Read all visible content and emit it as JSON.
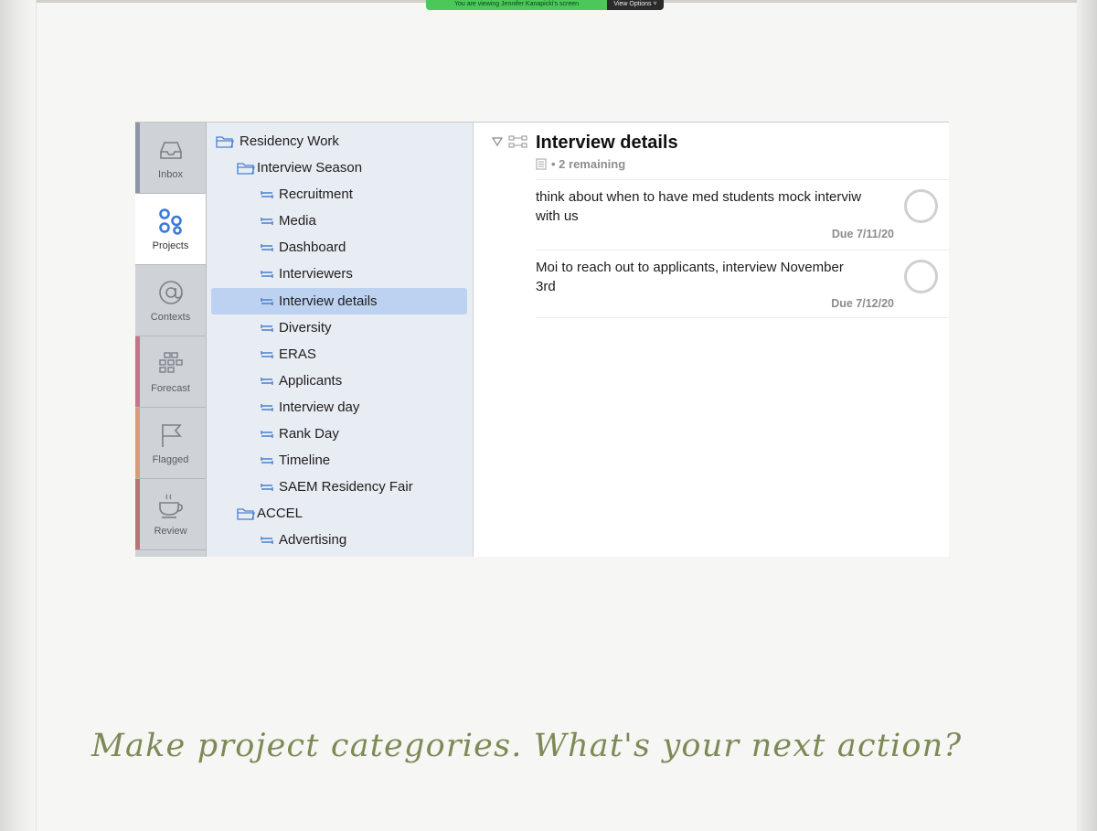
{
  "share_banner": {
    "message": "You are viewing Jennifer Kanapicki's screen",
    "options": "View Options ˅"
  },
  "perspectives": [
    {
      "label": "Inbox",
      "icon": "inbox-icon",
      "color": "#8e95a6"
    },
    {
      "label": "Projects",
      "icon": "projects-icon",
      "color": "#3b7ad8"
    },
    {
      "label": "Contexts",
      "icon": "at-icon",
      "color": "#8a8d92"
    },
    {
      "label": "Forecast",
      "icon": "calendar-grid-icon",
      "color": "#c8738a"
    },
    {
      "label": "Flagged",
      "icon": "flag-icon",
      "color": "#d99b7a"
    },
    {
      "label": "Review",
      "icon": "coffee-cup-icon",
      "color": "#b87576"
    }
  ],
  "sidebar": {
    "items": [
      {
        "label": "Residency Work",
        "type": "folder"
      },
      {
        "label": "Interview Season",
        "type": "folder"
      },
      {
        "label": "Recruitment",
        "type": "project"
      },
      {
        "label": "Media",
        "type": "project"
      },
      {
        "label": "Dashboard",
        "type": "project"
      },
      {
        "label": "Interviewers",
        "type": "project"
      },
      {
        "label": "Interview details",
        "type": "project",
        "selected": true
      },
      {
        "label": "Diversity",
        "type": "project"
      },
      {
        "label": "ERAS",
        "type": "project"
      },
      {
        "label": "Applicants",
        "type": "project"
      },
      {
        "label": "Interview day",
        "type": "project"
      },
      {
        "label": "Rank Day",
        "type": "project"
      },
      {
        "label": "Timeline",
        "type": "project"
      },
      {
        "label": "SAEM Residency Fair",
        "type": "project"
      },
      {
        "label": "ACCEL",
        "type": "folder"
      },
      {
        "label": "Advertising",
        "type": "project"
      }
    ]
  },
  "content": {
    "title": "Interview details",
    "remaining": "• 2 remaining",
    "tasks": [
      {
        "text": "think about when to have med students mock interviw with us",
        "due": "Due 7/11/20"
      },
      {
        "text": "Moi to reach out to applicants, interview November 3rd",
        "due": "Due 7/12/20"
      }
    ]
  },
  "caption": "Make project categories.  What's your next action?"
}
